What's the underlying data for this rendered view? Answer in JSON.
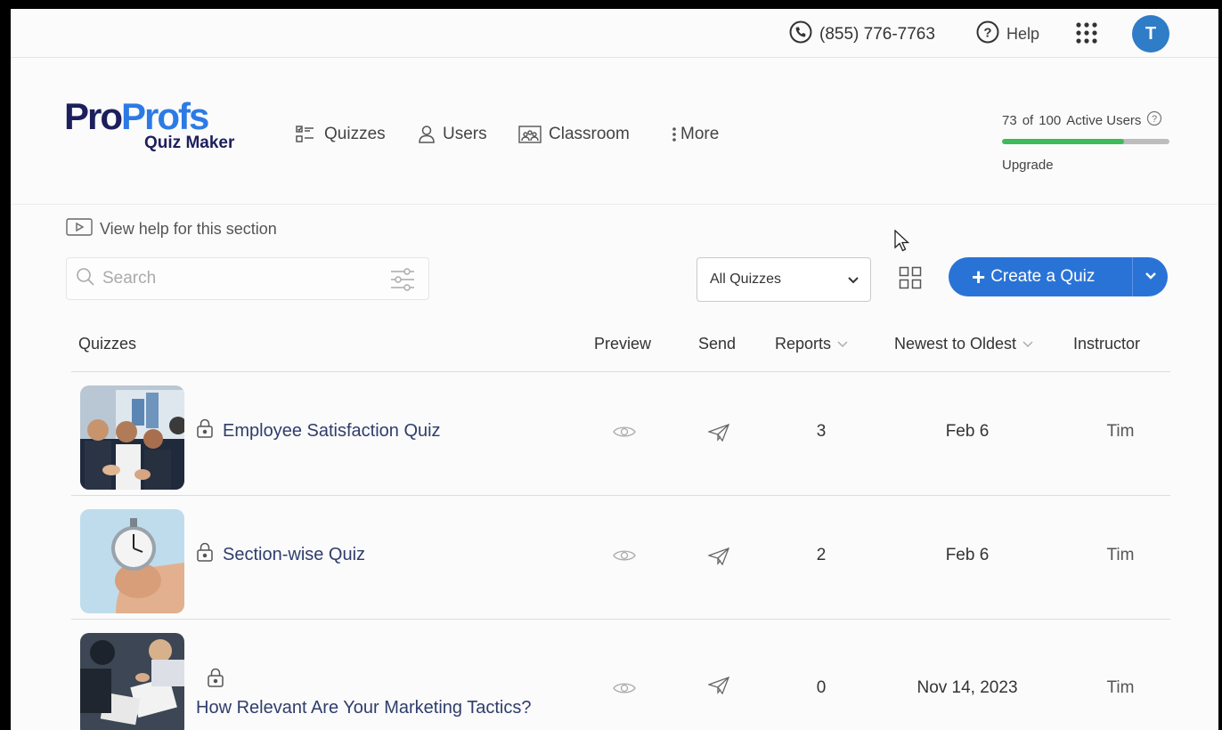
{
  "topbar": {
    "phone": "(855) 776-7763",
    "help_label": "Help",
    "avatar_initial": "T"
  },
  "header": {
    "logo_brand_part1": "Pro",
    "logo_brand_part2": "Profs",
    "logo_sub": "Quiz Maker",
    "nav": {
      "quizzes": "Quizzes",
      "users": "Users",
      "classroom": "Classroom",
      "more": "More"
    },
    "active_users": {
      "active": "73",
      "of": "of",
      "total": "100",
      "label": "Active Users",
      "fraction": 0.73,
      "upgrade": "Upgrade"
    }
  },
  "controls": {
    "help_link": "View help for this section",
    "search_placeholder": "Search",
    "filter_select": "All Quizzes",
    "create_button": "Create a Quiz"
  },
  "table": {
    "headers": {
      "quizzes": "Quizzes",
      "preview": "Preview",
      "send": "Send",
      "reports": "Reports",
      "sort": "Newest to Oldest",
      "instructor": "Instructor"
    },
    "rows": [
      {
        "title": "Employee Satisfaction Quiz",
        "reports": "3",
        "date": "Feb 6",
        "instructor": "Tim"
      },
      {
        "title": "Section-wise Quiz",
        "reports": "2",
        "date": "Feb 6",
        "instructor": "Tim"
      },
      {
        "title": "How Relevant Are Your Marketing Tactics?",
        "reports": "0",
        "date": "Nov 14, 2023",
        "instructor": "Tim"
      }
    ]
  },
  "colors": {
    "primary": "#2a73d6",
    "brand_dark": "#1d1f5c",
    "brand_blue": "#2c7be5",
    "progress": "#3dbb5a",
    "avatar": "#2f7cc7"
  }
}
